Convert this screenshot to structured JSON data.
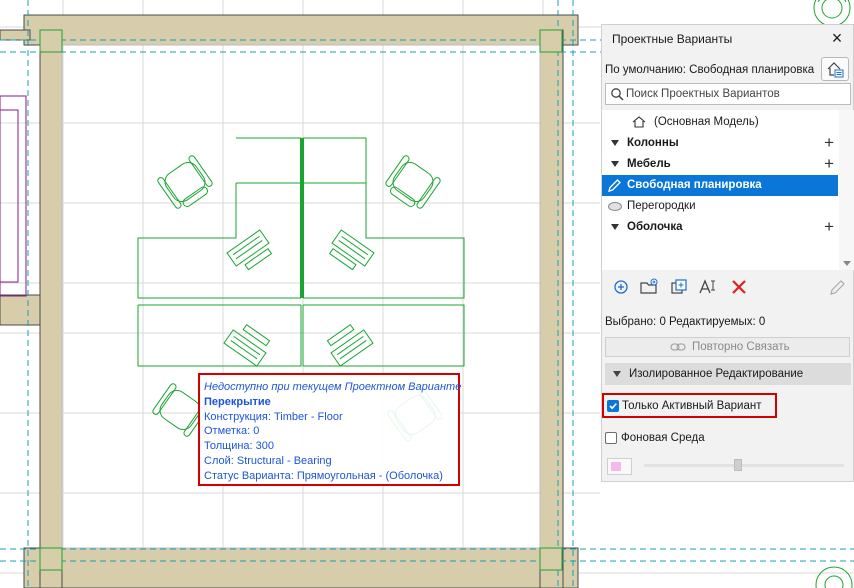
{
  "tooltip": {
    "unavailable": "Недоступно при текущем Проектном Варианте",
    "element": "Перекрытие",
    "construction": "Конструкция: Timber - Floor",
    "elevation": "Отметка: 0",
    "thickness": "Толщина: 300",
    "layer": "Слой: Structural - Bearing",
    "option_status": "Статус Варианта: Прямоугольная -  (Оболочка)"
  },
  "panel": {
    "title": "Проектные Варианты",
    "close_icon": "close-icon",
    "default_line": "По умолчанию: Свободная планировка",
    "manage_icon": "house-options-icon",
    "search_placeholder": "Поиск Проектных Вариантов",
    "search_value": "",
    "tree": [
      {
        "label": "(Основная Модель)",
        "icon": "house-icon",
        "bold": false,
        "arrow": false,
        "plus": false,
        "selected": false
      },
      {
        "label": "Колонны",
        "bold": true,
        "arrow": true,
        "plus": true,
        "selected": false
      },
      {
        "label": "Мебель",
        "bold": true,
        "arrow": true,
        "plus": true,
        "selected": false
      },
      {
        "label": "Свободная планировка",
        "icon": "pencil-icon",
        "bold": true,
        "arrow": false,
        "plus": false,
        "selected": true
      },
      {
        "label": "Перегородки",
        "icon": "ellipse-icon",
        "bold": false,
        "arrow": false,
        "plus": false,
        "selected": false
      },
      {
        "label": "Оболочка",
        "bold": true,
        "arrow": true,
        "plus": true,
        "selected": false
      }
    ],
    "toolbar_icons": [
      "add-circle-icon",
      "new-folder-icon",
      "duplicate-icon",
      "rename-text-icon",
      "delete-x-icon",
      "edit-pencil-icon"
    ],
    "selection_info": "Выбрано: 0 Редактируемых: 0",
    "relink_label": "Повторно Связать",
    "isolated_section": "Изолированное Редактирование",
    "only_active_label": "Только Активный Вариант",
    "only_active_checked": true,
    "background_label": "Фоновая Среда",
    "background_checked": false,
    "background_color": "#f4b8ec",
    "opacity_level": 0.47
  },
  "colors": {
    "accent": "#0a76d8",
    "highlight": "#d40000",
    "tooltip_text": "#1e55d8",
    "wall": "#d7cdaa",
    "furniture": "#1aa531"
  }
}
